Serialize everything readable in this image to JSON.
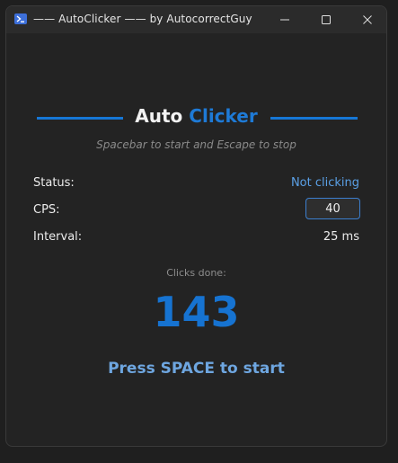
{
  "window": {
    "title": "—— AutoClicker —— by AutocorrectGuy",
    "icon": "terminal-app-icon",
    "controls": [
      "minimize-icon",
      "maximize-icon",
      "close-icon"
    ]
  },
  "header": {
    "title_part1": "Auto",
    "title_part2": "Clicker",
    "subtitle": "Spacebar to start and Escape to stop"
  },
  "fields": {
    "status_label": "Status:",
    "status_value": "Not clicking",
    "cps_label": "CPS:",
    "cps_value": "40",
    "interval_label": "Interval:",
    "interval_value": "25 ms"
  },
  "counter": {
    "caption": "Clicks done:",
    "value": "143"
  },
  "prompt": "Press SPACE to start",
  "colors": {
    "accent": "#1e7ad6",
    "status": "#5aa0e6",
    "prompt": "#6ea6e0",
    "background": "#232323"
  }
}
